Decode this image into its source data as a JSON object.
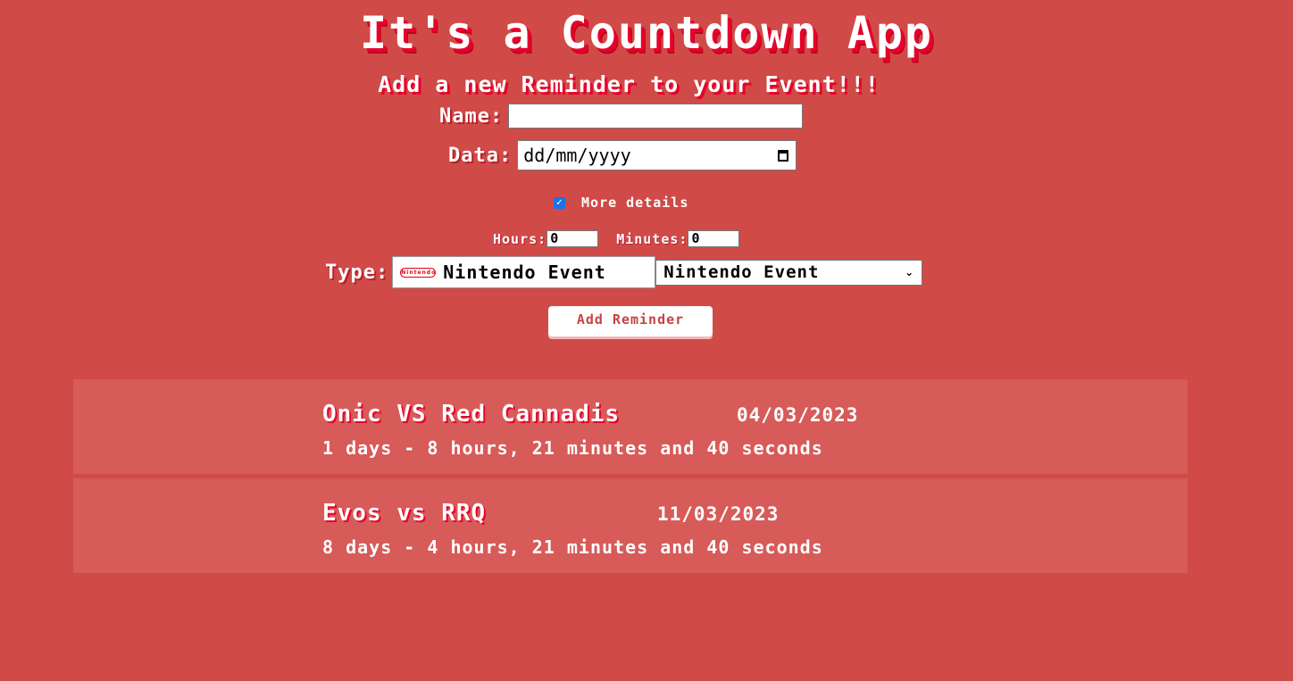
{
  "app": {
    "title": "It's a Countdown App",
    "subtitle": "Add a new Reminder to your Event!!!"
  },
  "form": {
    "name_label": "Name:",
    "name_value": "",
    "date_label": "Data:",
    "date_placeholder": "dd/mm/yyyy",
    "more_details_checked": true,
    "more_details_label": "More details",
    "hours_label": "Hours:",
    "hours_value": "0",
    "minutes_label": "Minutes:",
    "minutes_value": "0",
    "type_label": "Type:",
    "type_display": "Nintendo Event",
    "type_logo_text": "Nintendo",
    "type_select_value": "Nintendo Event",
    "add_button": "Add Reminder"
  },
  "reminders": [
    {
      "name": "Onic VS Red Cannadis",
      "date": "04/03/2023",
      "countdown": "1 days - 8 hours, 21 minutes and 40 seconds"
    },
    {
      "name": "Evos vs RRQ",
      "date": "11/03/2023",
      "countdown": "8 days - 4 hours, 21 minutes and 40 seconds"
    }
  ],
  "colors": {
    "background": "#d04a48",
    "card": "#d65b59",
    "shadow": "#e8002a",
    "checkbox": "#1a73e8"
  },
  "icons": {
    "calendar": "calendar-icon",
    "nintendo": "nintendo-logo-icon",
    "select_chevron": "chevron-down-icon",
    "checkbox": "checkmark-icon"
  }
}
